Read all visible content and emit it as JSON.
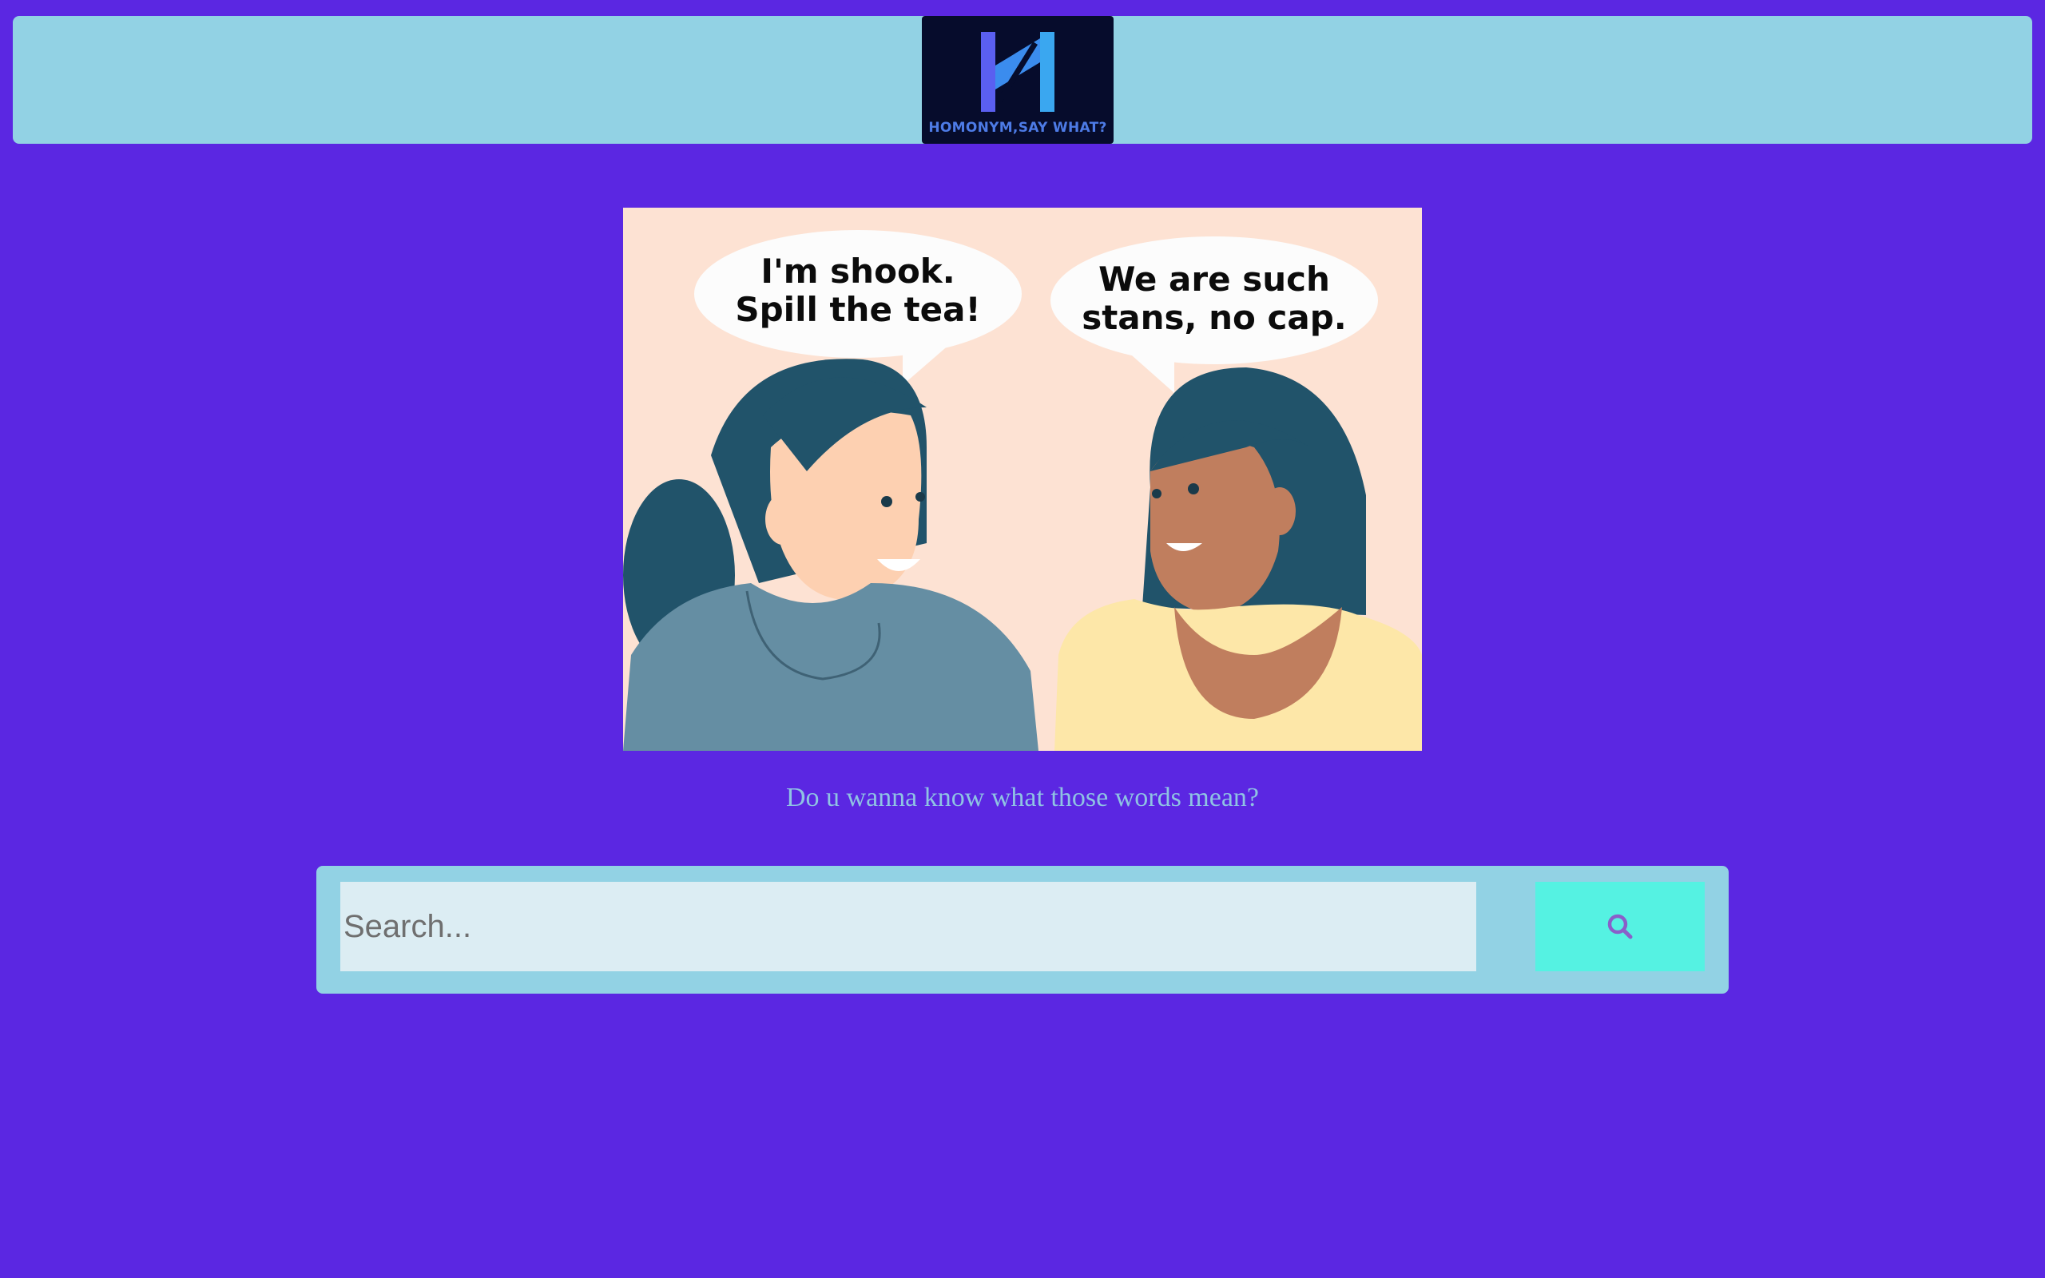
{
  "header": {
    "logo_text": "HOMONYM,SAY WHAT?",
    "logo_icon": "h-monogram-icon"
  },
  "hero": {
    "bubble_left_line1": "I'm shook.",
    "bubble_left_line2": "Spill the tea!",
    "bubble_right_line1": "We are such",
    "bubble_right_line2": "stans, no cap."
  },
  "tagline": "Do u wanna know what those words mean?",
  "search": {
    "placeholder": "Search...",
    "value": "",
    "button_icon": "search-icon"
  },
  "colors": {
    "background": "#5b27e2",
    "header": "#92d2e4",
    "logo_bg": "#060c2c",
    "search_button": "#55f2e2",
    "tagline": "#8fc3e3"
  }
}
